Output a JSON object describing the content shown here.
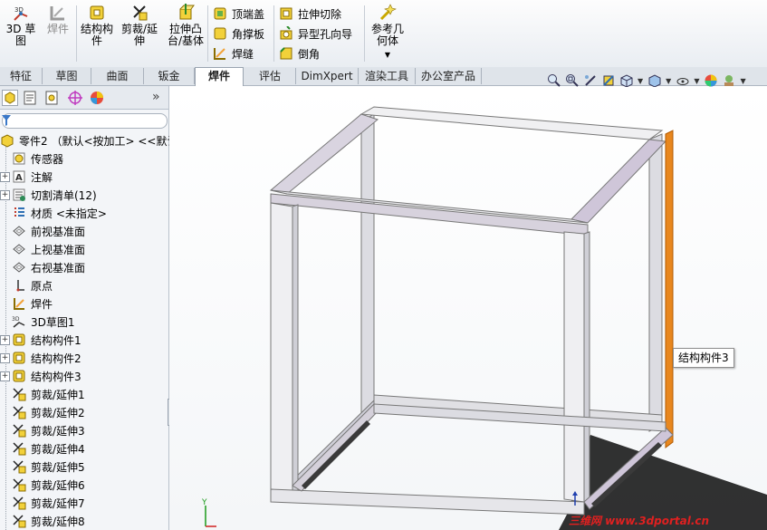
{
  "ribbon": {
    "btn_3dsketch": "3D 草图",
    "btn_weldment": "焊件",
    "btn_structural": [
      "结构构",
      "件"
    ],
    "btn_trim": [
      "剪裁/延",
      "伸"
    ],
    "btn_extrude": [
      "拉伸凸",
      "台/基体"
    ],
    "btn_endcap": "顶端盖",
    "btn_gusset": "角撑板",
    "btn_weldbead": "焊缝",
    "btn_extcut": "拉伸切除",
    "btn_hole": "异型孔向导",
    "btn_chamfer": "倒角",
    "btn_refgeom": [
      "参考几",
      "何体"
    ]
  },
  "tabs": [
    "特征",
    "草图",
    "曲面",
    "钣金",
    "焊件",
    "评估",
    "DimXpert",
    "渲染工具",
    "办公室产品"
  ],
  "active_tab": "焊件",
  "panel": {
    "collapse_label": "»"
  },
  "tree": {
    "root": "零件2 （默认<按加工> <<默认>",
    "items": [
      {
        "label": "传感器",
        "icon": "sensor-icon",
        "exp": false
      },
      {
        "label": "注解",
        "icon": "annotation-icon",
        "exp": true
      },
      {
        "label": "切割清单(12)",
        "icon": "cutlist-icon",
        "exp": true
      },
      {
        "label": "材质 <未指定>",
        "icon": "material-icon",
        "exp": false
      },
      {
        "label": "前视基准面",
        "icon": "plane-icon",
        "exp": false
      },
      {
        "label": "上视基准面",
        "icon": "plane-icon",
        "exp": false
      },
      {
        "label": "右视基准面",
        "icon": "plane-icon",
        "exp": false
      },
      {
        "label": "原点",
        "icon": "origin-icon",
        "exp": false
      },
      {
        "label": "焊件",
        "icon": "weldment-icon",
        "exp": false
      },
      {
        "label": "3D草图1",
        "icon": "sketch3d-icon",
        "exp": false
      },
      {
        "label": "结构构件1",
        "icon": "structural-member-icon",
        "exp": true
      },
      {
        "label": "结构构件2",
        "icon": "structural-member-icon",
        "exp": true
      },
      {
        "label": "结构构件3",
        "icon": "structural-member-icon",
        "exp": true
      },
      {
        "label": "剪裁/延伸1",
        "icon": "trim-extend-icon",
        "exp": false
      },
      {
        "label": "剪裁/延伸2",
        "icon": "trim-extend-icon",
        "exp": false
      },
      {
        "label": "剪裁/延伸3",
        "icon": "trim-extend-icon",
        "exp": false
      },
      {
        "label": "剪裁/延伸4",
        "icon": "trim-extend-icon",
        "exp": false
      },
      {
        "label": "剪裁/延伸5",
        "icon": "trim-extend-icon",
        "exp": false
      },
      {
        "label": "剪裁/延伸6",
        "icon": "trim-extend-icon",
        "exp": false
      },
      {
        "label": "剪裁/延伸7",
        "icon": "trim-extend-icon",
        "exp": false
      },
      {
        "label": "剪裁/延伸8",
        "icon": "trim-extend-icon",
        "exp": false
      }
    ]
  },
  "tooltip": "结构构件3",
  "watermark": "三维网 www.3dportal.cn",
  "triad": {
    "y": "Y",
    "x": "X"
  },
  "colors": {
    "accent_orange": "#e8871e",
    "frame_gray": "#e6e6ea"
  }
}
